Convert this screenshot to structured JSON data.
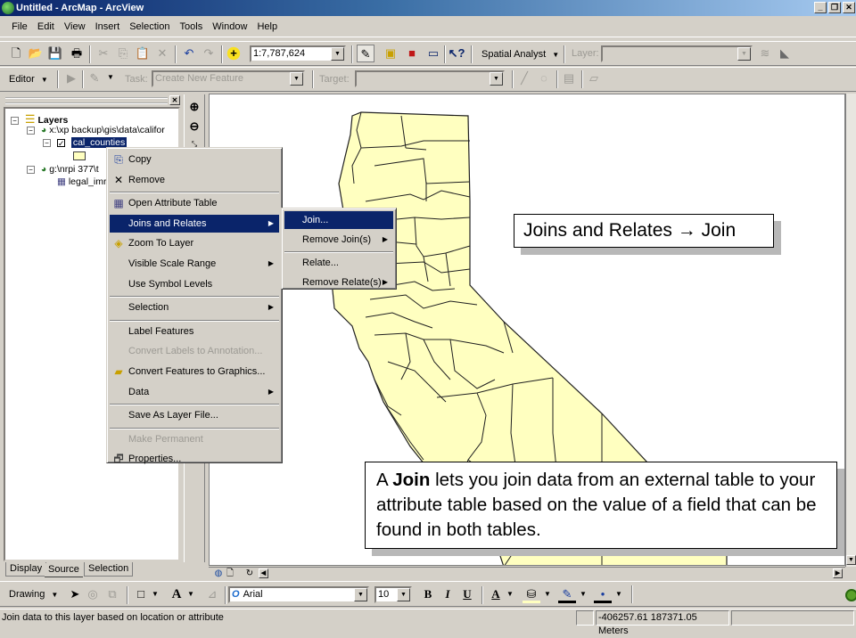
{
  "window": {
    "title": "Untitled - ArcMap - ArcView",
    "controls": [
      "_",
      "❐",
      "✕"
    ]
  },
  "menubar": [
    "File",
    "Edit",
    "View",
    "Insert",
    "Selection",
    "Tools",
    "Window",
    "Help"
  ],
  "standard_toolbar": {
    "scale_value": "1:7,787,624",
    "spatial_analyst_label": "Spatial Analyst",
    "layer_label": "Layer:",
    "layer_value": ""
  },
  "editor_toolbar": {
    "editor_label": "Editor",
    "task_label": "Task:",
    "task_value": "Create New Feature",
    "target_label": "Target:",
    "target_value": ""
  },
  "toc": {
    "root": "Layers",
    "items": [
      {
        "label": "x:\\xp backup\\gis\\data\\califor",
        "level": 1,
        "type": "data-frame"
      },
      {
        "label": "cal_counties",
        "level": 2,
        "type": "layer",
        "checked": true,
        "selected": true
      },
      {
        "label": "g:\\nrpi 377\\t",
        "level": 1,
        "type": "data-frame"
      },
      {
        "label": "legal_imr",
        "level": 2,
        "type": "table"
      }
    ],
    "symbol_color": "#ffffc0",
    "tabs": [
      "Display",
      "Source",
      "Selection"
    ],
    "active_tab": "Source"
  },
  "context_menu": {
    "items": [
      {
        "label": "Copy",
        "icon": "copy-icon"
      },
      {
        "label": "Remove",
        "icon": "remove-icon"
      },
      {
        "sep": true
      },
      {
        "label": "Open Attribute Table",
        "icon": "table-icon"
      },
      {
        "label": "Joins and Relates",
        "submenu": true,
        "highlighted": true
      },
      {
        "label": "Zoom To Layer",
        "icon": "zoom-to-layer-icon"
      },
      {
        "label": "Visible Scale Range",
        "submenu": true
      },
      {
        "label": "Use Symbol Levels"
      },
      {
        "sep": true
      },
      {
        "label": "Selection",
        "submenu": true
      },
      {
        "sep": true
      },
      {
        "label": "Label Features"
      },
      {
        "label": "Convert Labels to Annotation...",
        "disabled": true
      },
      {
        "label": "Convert Features to Graphics...",
        "icon": "convert-graphics-icon"
      },
      {
        "label": "Data",
        "submenu": true
      },
      {
        "sep": true
      },
      {
        "label": "Save As Layer File..."
      },
      {
        "sep": true
      },
      {
        "label": "Make Permanent",
        "disabled": true
      },
      {
        "label": "Properties...",
        "icon": "properties-icon"
      }
    ]
  },
  "submenu": {
    "items": [
      {
        "label": "Join...",
        "highlighted": true
      },
      {
        "label": "Remove Join(s)",
        "submenu": true
      },
      {
        "label": "Relate..."
      },
      {
        "label": "Remove Relate(s)",
        "submenu": true
      }
    ]
  },
  "callouts": {
    "top": "Joins and Relates → Join",
    "bottom_prefix": "A ",
    "bottom_bold": "Join",
    "bottom_rest": " lets you join data from an external table to your attribute table based on the value of a field that can be found in both tables."
  },
  "map": {
    "fill_color": "#ffffc0",
    "outline_color": "#202020"
  },
  "drawing_toolbar": {
    "drawing_label": "Drawing",
    "font_value": "Arial",
    "size_value": "10",
    "bold": "B",
    "italic": "I",
    "underline": "U"
  },
  "status": {
    "message": "Join data to this layer based on location or attribute",
    "coordinates": "-406257.61  187371.05 Meters"
  }
}
